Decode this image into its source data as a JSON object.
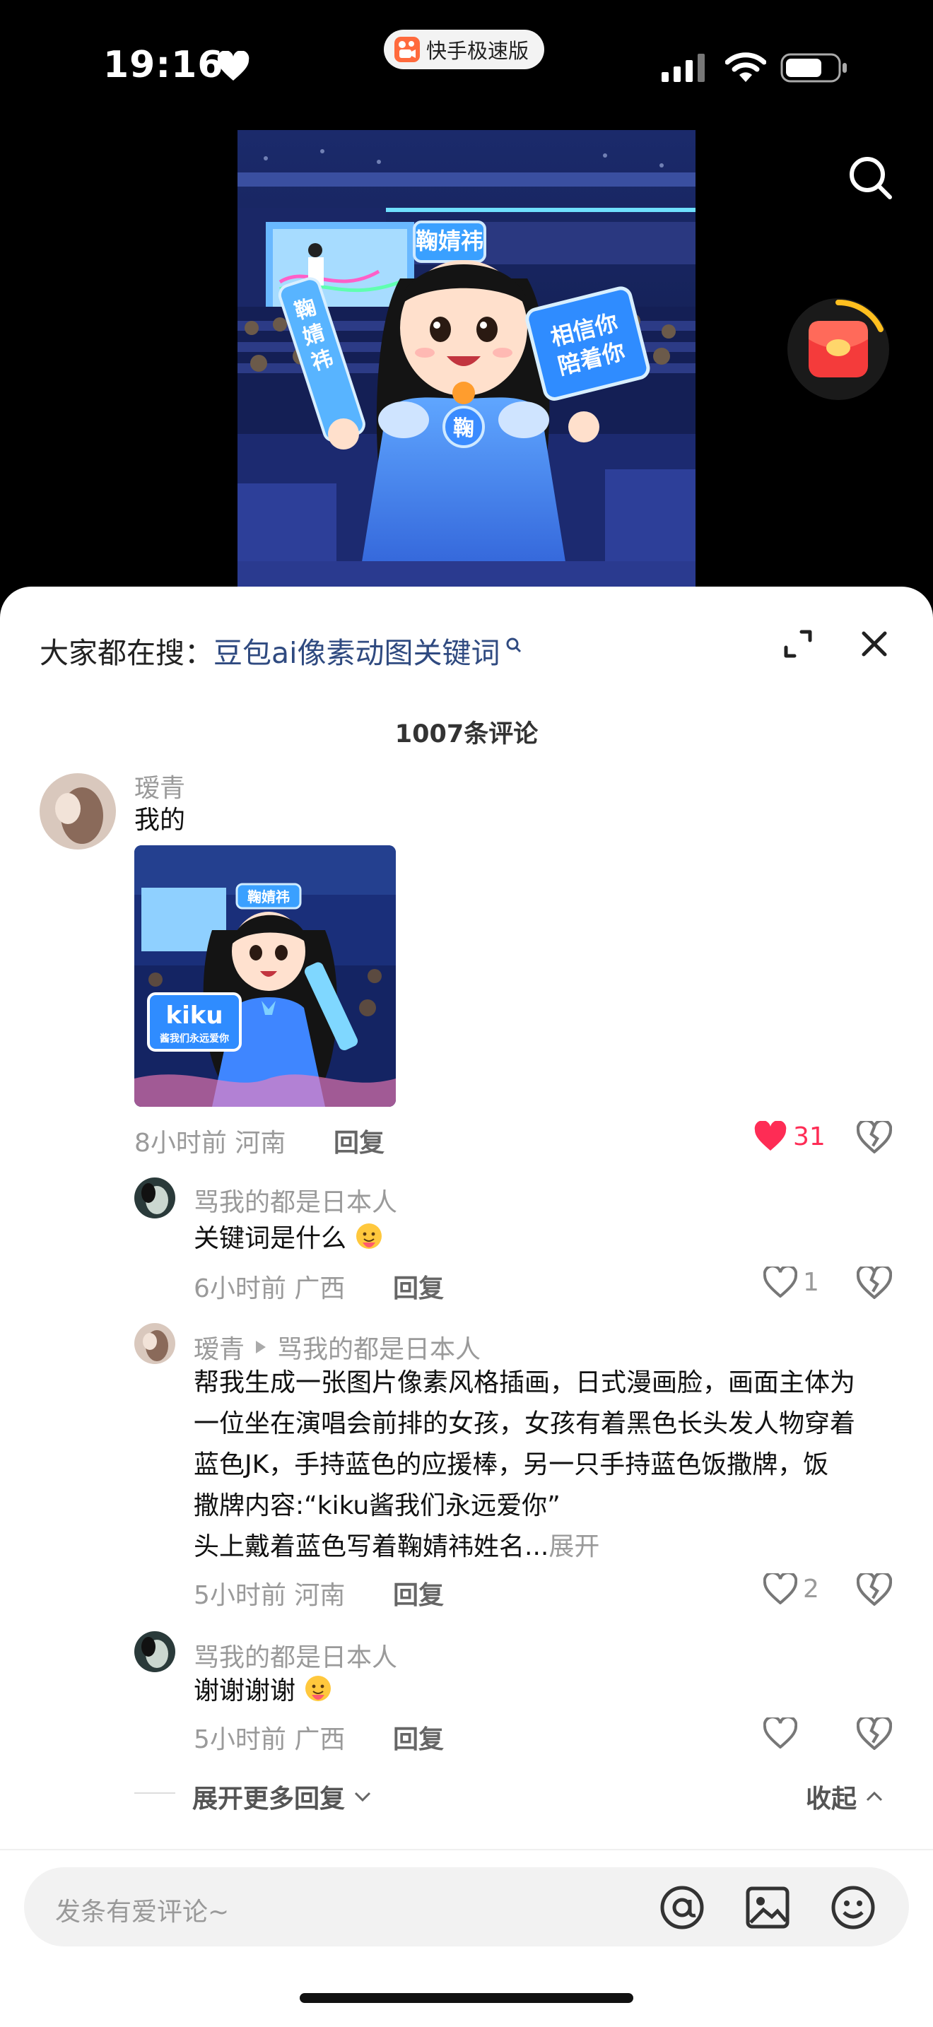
{
  "status": {
    "time": "19:16",
    "app_badge": "快手极速版"
  },
  "sheet": {
    "hot_search_prefix": "大家都在搜：",
    "hot_search_keyword": "豆包ai像素动图关键词",
    "comment_count": "1007条评论"
  },
  "comments": [
    {
      "user": "瑷青",
      "text": "我的",
      "time": "8小时前",
      "location": "河南",
      "reply_label": "回复",
      "likes": "31",
      "liked": true,
      "image_text": {
        "banner": "鞠婧祎",
        "sign_main": "kiku",
        "sign_sub": "酱我们永远爱你"
      }
    },
    {
      "user": "骂我的都是日本人",
      "text": "关键词是什么",
      "time": "6小时前",
      "location": "广西",
      "reply_label": "回复",
      "likes": "1"
    },
    {
      "user": "瑷青",
      "reply_to": "骂我的都是日本人",
      "text_lines": [
        "帮我生成一张图片像素风格插画，日式漫画脸，画面主体为",
        "一位坐在演唱会前排的女孩，女孩有着黑色长头发人物穿着",
        "蓝色JK，手持蓝色的应援棒，另一只手持蓝色饭撒牌，饭",
        "撒牌内容:“kiku酱我们永远爱你”"
      ],
      "last_line": "头上戴着蓝色写着鞠婧祎姓名...",
      "expand_label": "展开",
      "time": "5小时前",
      "location": "河南",
      "reply_label": "回复",
      "likes": "2"
    },
    {
      "user": "骂我的都是日本人",
      "text": "谢谢谢谢",
      "time": "5小时前",
      "location": "广西",
      "reply_label": "回复",
      "likes": ""
    }
  ],
  "more_replies_label": "展开更多回复",
  "collapse_label": "收起",
  "input_placeholder": "发条有爱评论~",
  "artwork_text": {
    "headband": "鞠婧祎",
    "stick": "鞠婧祎",
    "sign": "相信你陪着你",
    "badge": "鞠"
  },
  "colors": {
    "like_red": "#fe2c55",
    "keyword_blue": "#2f4a80",
    "sheet_bg": "#ffffff"
  }
}
